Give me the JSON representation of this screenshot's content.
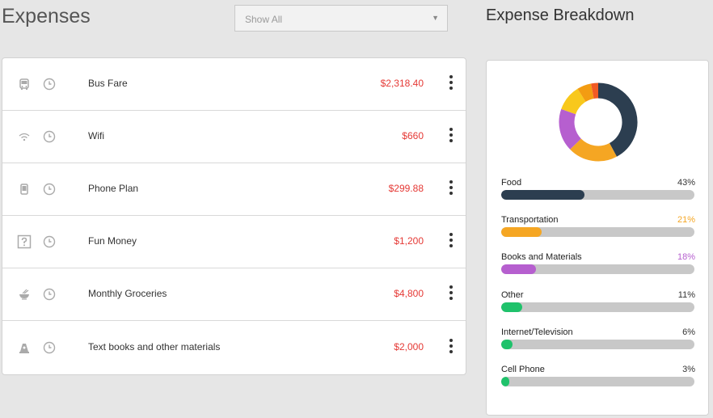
{
  "header": {
    "title": "Expenses"
  },
  "filter": {
    "selected": "Show All"
  },
  "expenses": [
    {
      "icon": "bus-icon",
      "name": "Bus Fare",
      "amount": "$2,318.40"
    },
    {
      "icon": "wifi-icon",
      "name": "Wifi",
      "amount": "$660"
    },
    {
      "icon": "phone-icon",
      "name": "Phone Plan",
      "amount": "$299.88"
    },
    {
      "icon": "question-icon",
      "name": "Fun Money",
      "amount": "$1,200"
    },
    {
      "icon": "food-bowl-icon",
      "name": "Monthly Groceries",
      "amount": "$4,800"
    },
    {
      "icon": "books-icon",
      "name": "Text books and other materials",
      "amount": "$2,000"
    }
  ],
  "breakdown": {
    "title": "Expense Breakdown",
    "categories": [
      {
        "name": "Food",
        "percent_label": "43%",
        "percent": 43,
        "color": "#2c3e50",
        "label_color": "#333333"
      },
      {
        "name": "Transportation",
        "percent_label": "21%",
        "percent": 21,
        "color": "#f5a623",
        "label_color": "#f5a623"
      },
      {
        "name": "Books and Materials",
        "percent_label": "18%",
        "percent": 18,
        "color": "#b65fcf",
        "label_color": "#b65fcf"
      },
      {
        "name": "Other",
        "percent_label": "11%",
        "percent": 11,
        "color": "#1fc26b",
        "label_color": "#333333"
      },
      {
        "name": "Internet/Television",
        "percent_label": "6%",
        "percent": 6,
        "color": "#1fc26b",
        "label_color": "#333333"
      },
      {
        "name": "Cell Phone",
        "percent_label": "3%",
        "percent": 3,
        "color": "#1fc26b",
        "label_color": "#333333"
      }
    ],
    "donut": [
      {
        "name": "Food",
        "percent": 43,
        "color": "#2c3e50"
      },
      {
        "name": "Transportation",
        "percent": 21,
        "color": "#f5a623"
      },
      {
        "name": "Books and Materials",
        "percent": 18,
        "color": "#b65fcf"
      },
      {
        "name": "Other",
        "percent": 11,
        "color": "#f8c81c"
      },
      {
        "name": "Internet/Television",
        "percent": 6,
        "color": "#f39c12"
      },
      {
        "name": "Cell Phone",
        "percent": 3,
        "color": "#f15a24"
      }
    ]
  },
  "colors": {
    "amount": "#e53935",
    "background": "#e6e6e6",
    "track": "#c8c8c8"
  }
}
